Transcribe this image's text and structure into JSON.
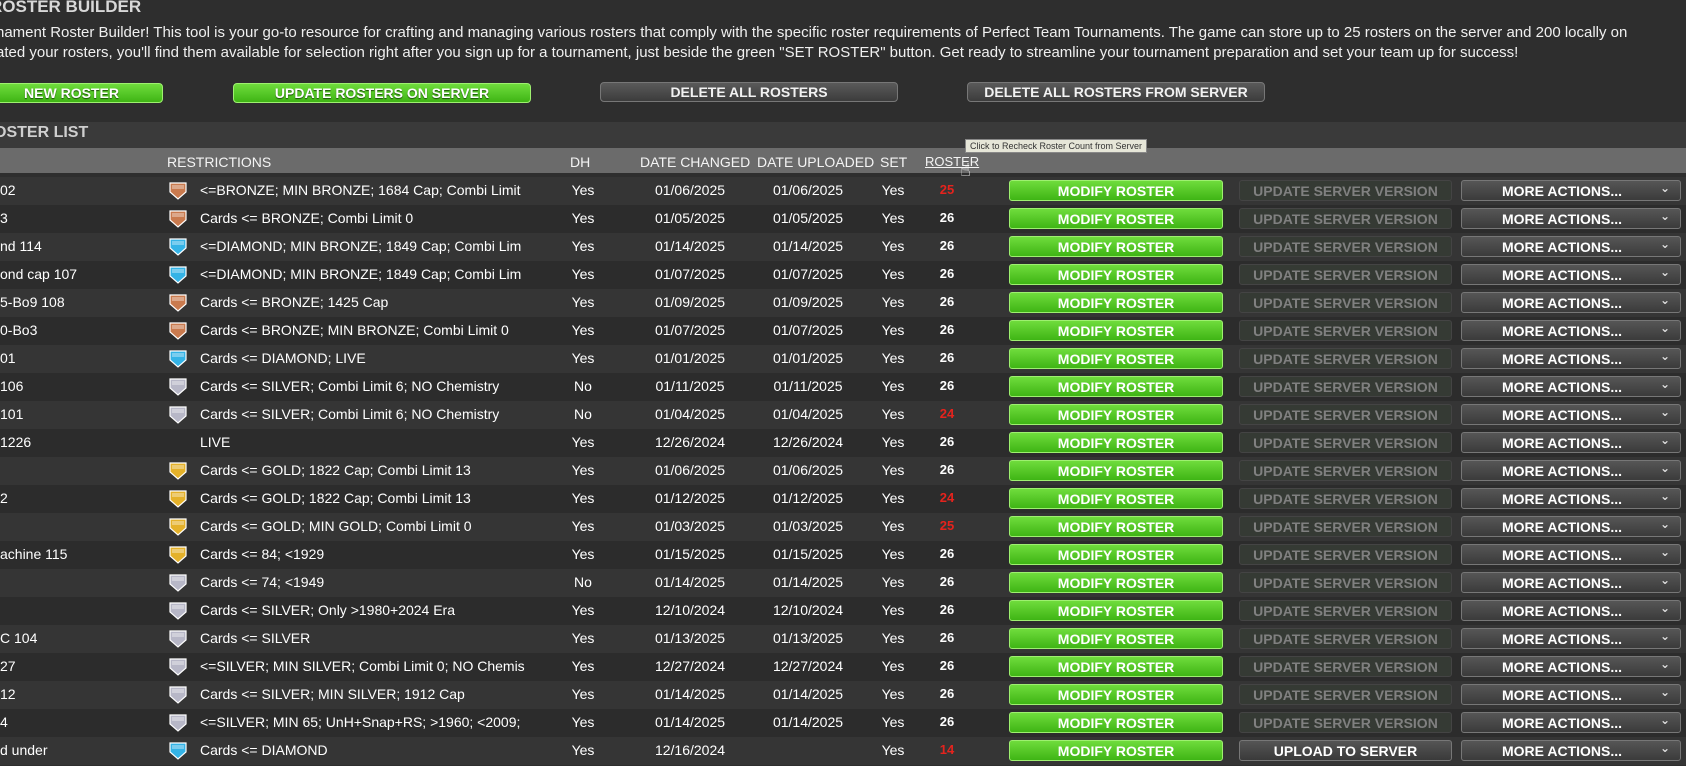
{
  "header": {
    "title": "ROSTER BUILDER",
    "intro_line1": "nament Roster Builder! This tool is your go-to resource for crafting and managing various rosters that comply with the specific roster requirements of Perfect Team Tournaments. The game can store up to 25 rosters on the server and 200 locally on",
    "intro_line2": "ated your rosters, you'll find them available for selection right after you sign up for a tournament, just beside the green \"SET ROSTER\" button. Get ready to streamline your tournament preparation and set your team up for success!"
  },
  "toolbar": {
    "new_roster": "NEW ROSTER",
    "update_rosters": "UPDATE ROSTERS ON SERVER",
    "delete_all": "DELETE ALL ROSTERS",
    "delete_all_server": "DELETE ALL ROSTERS FROM SERVER"
  },
  "list": {
    "title": "OSTER LIST",
    "columns": {
      "restrictions": "RESTRICTIONS",
      "dh": "DH",
      "date_changed": "DATE CHANGED",
      "date_uploaded": "DATE UPLOADED",
      "set": "SET",
      "roster": "ROSTER"
    },
    "tooltip": "Click to Recheck Roster Count from Server"
  },
  "actions": {
    "modify": "MODIFY ROSTER",
    "update_server": "UPDATE SERVER VERSION",
    "upload_server": "UPLOAD TO SERVER",
    "more": "MORE ACTIONS..."
  },
  "colors": {
    "bronze": "#c97a4e",
    "diamond": "#34b3e6",
    "silver": "#b7b7c7",
    "gold": "#e4b12a",
    "count_ok": "#ffffff",
    "count_bad": "#e5231d"
  },
  "rows": [
    {
      "name": "02",
      "badge": "bronze",
      "restrictions": "<=BRONZE; MIN BRONZE; 1684 Cap; Combi Limit",
      "dh": "Yes",
      "changed": "01/06/2025",
      "uploaded": "01/06/2025",
      "set": "Yes",
      "count": "25",
      "count_status": "bad",
      "server": "update"
    },
    {
      "name": "3",
      "badge": "bronze",
      "restrictions": "Cards <= BRONZE; Combi Limit 0",
      "dh": "Yes",
      "changed": "01/05/2025",
      "uploaded": "01/05/2025",
      "set": "Yes",
      "count": "26",
      "count_status": "ok",
      "server": "update"
    },
    {
      "name": "nd 114",
      "badge": "diamond",
      "restrictions": "<=DIAMOND; MIN BRONZE; 1849 Cap; Combi Lim",
      "dh": "Yes",
      "changed": "01/14/2025",
      "uploaded": "01/14/2025",
      "set": "Yes",
      "count": "26",
      "count_status": "ok",
      "server": "update"
    },
    {
      "name": "ond cap 107",
      "badge": "diamond",
      "restrictions": "<=DIAMOND; MIN BRONZE; 1849 Cap; Combi Lim",
      "dh": "Yes",
      "changed": "01/07/2025",
      "uploaded": "01/07/2025",
      "set": "Yes",
      "count": "26",
      "count_status": "ok",
      "server": "update"
    },
    {
      "name": "5-Bo9    108",
      "badge": "bronze",
      "restrictions": "Cards <= BRONZE; 1425 Cap",
      "dh": "Yes",
      "changed": "01/09/2025",
      "uploaded": "01/09/2025",
      "set": "Yes",
      "count": "26",
      "count_status": "ok",
      "server": "update"
    },
    {
      "name": "0-Bo3",
      "badge": "bronze",
      "restrictions": "Cards <= BRONZE; MIN BRONZE; Combi Limit 0",
      "dh": "Yes",
      "changed": "01/07/2025",
      "uploaded": "01/07/2025",
      "set": "Yes",
      "count": "26",
      "count_status": "ok",
      "server": "update"
    },
    {
      "name": "01",
      "badge": "diamond",
      "restrictions": "Cards <= DIAMOND; LIVE",
      "dh": "Yes",
      "changed": "01/01/2025",
      "uploaded": "01/01/2025",
      "set": "Yes",
      "count": "26",
      "count_status": "ok",
      "server": "update"
    },
    {
      "name": "106",
      "badge": "silver",
      "restrictions": "Cards <= SILVER; Combi Limit 6; NO Chemistry",
      "dh": "No",
      "changed": "01/11/2025",
      "uploaded": "01/11/2025",
      "set": "Yes",
      "count": "26",
      "count_status": "ok",
      "server": "update"
    },
    {
      "name": "101",
      "badge": "silver",
      "restrictions": "Cards <= SILVER; Combi Limit 6; NO Chemistry",
      "dh": "No",
      "changed": "01/04/2025",
      "uploaded": "01/04/2025",
      "set": "Yes",
      "count": "24",
      "count_status": "bad",
      "server": "update"
    },
    {
      "name": "1226",
      "badge": "none",
      "restrictions": "LIVE",
      "dh": "Yes",
      "changed": "12/26/2024",
      "uploaded": "12/26/2024",
      "set": "Yes",
      "count": "26",
      "count_status": "ok",
      "server": "update"
    },
    {
      "name": "",
      "badge": "gold",
      "restrictions": "Cards <= GOLD; 1822 Cap; Combi Limit 13",
      "dh": "Yes",
      "changed": "01/06/2025",
      "uploaded": "01/06/2025",
      "set": "Yes",
      "count": "26",
      "count_status": "ok",
      "server": "update"
    },
    {
      "name": "2",
      "badge": "gold",
      "restrictions": "Cards <= GOLD; 1822 Cap; Combi Limit 13",
      "dh": "Yes",
      "changed": "01/12/2025",
      "uploaded": "01/12/2025",
      "set": "Yes",
      "count": "24",
      "count_status": "bad",
      "server": "update"
    },
    {
      "name": "",
      "badge": "gold",
      "restrictions": "Cards <= GOLD; MIN GOLD; Combi Limit 0",
      "dh": "Yes",
      "changed": "01/03/2025",
      "uploaded": "01/03/2025",
      "set": "Yes",
      "count": "25",
      "count_status": "bad",
      "server": "update"
    },
    {
      "name": "achine 115",
      "badge": "gold",
      "restrictions": "Cards <= 84; <1929",
      "dh": "Yes",
      "changed": "01/15/2025",
      "uploaded": "01/15/2025",
      "set": "Yes",
      "count": "26",
      "count_status": "ok",
      "server": "update"
    },
    {
      "name": "",
      "badge": "silver",
      "restrictions": "Cards <= 74; <1949",
      "dh": "No",
      "changed": "01/14/2025",
      "uploaded": "01/14/2025",
      "set": "Yes",
      "count": "26",
      "count_status": "ok",
      "server": "update"
    },
    {
      "name": "",
      "badge": "silver",
      "restrictions": "Cards <= SILVER; Only >1980+2024 Era",
      "dh": "Yes",
      "changed": "12/10/2024",
      "uploaded": "12/10/2024",
      "set": "Yes",
      "count": "26",
      "count_status": "ok",
      "server": "update"
    },
    {
      "name": "C 104",
      "badge": "silver",
      "restrictions": "Cards <= SILVER",
      "dh": "Yes",
      "changed": "01/13/2025",
      "uploaded": "01/13/2025",
      "set": "Yes",
      "count": "26",
      "count_status": "ok",
      "server": "update"
    },
    {
      "name": "27",
      "badge": "silver",
      "restrictions": "<=SILVER; MIN SILVER; Combi Limit 0; NO Chemis",
      "dh": "Yes",
      "changed": "12/27/2024",
      "uploaded": "12/27/2024",
      "set": "Yes",
      "count": "26",
      "count_status": "ok",
      "server": "update"
    },
    {
      "name": "12",
      "badge": "silver",
      "restrictions": "Cards <= SILVER; MIN SILVER; 1912 Cap",
      "dh": "Yes",
      "changed": "01/14/2025",
      "uploaded": "01/14/2025",
      "set": "Yes",
      "count": "26",
      "count_status": "ok",
      "server": "update"
    },
    {
      "name": "4",
      "badge": "silver",
      "restrictions": "<=SILVER; MIN 65; UnH+Snap+RS; >1960; <2009;",
      "dh": "Yes",
      "changed": "01/14/2025",
      "uploaded": "01/14/2025",
      "set": "Yes",
      "count": "26",
      "count_status": "ok",
      "server": "update"
    },
    {
      "name": "d under",
      "badge": "diamond",
      "restrictions": "Cards <= DIAMOND",
      "dh": "Yes",
      "changed": "12/16/2024",
      "uploaded": "",
      "set": "Yes",
      "count": "14",
      "count_status": "bad",
      "server": "upload"
    }
  ]
}
